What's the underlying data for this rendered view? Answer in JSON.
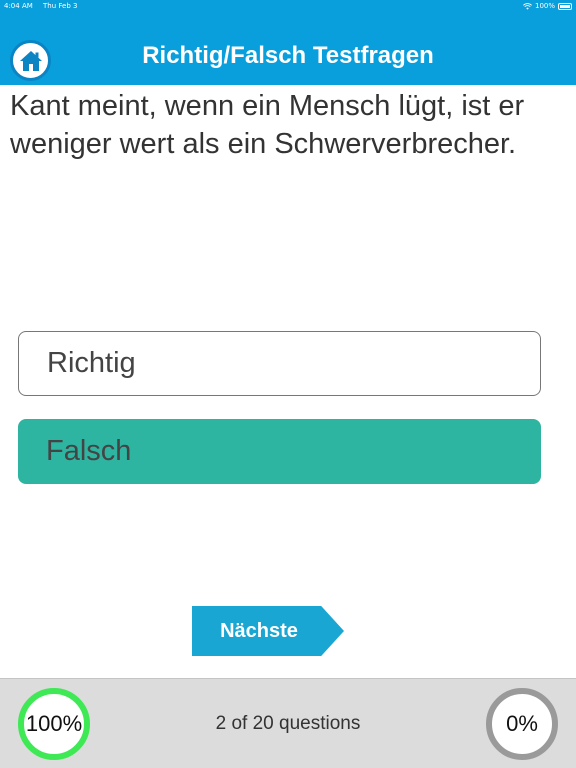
{
  "status_bar": {
    "time": "4:04 AM",
    "date": "Thu Feb 3",
    "battery": "100%",
    "icons": {
      "wifi": "wifi-icon",
      "battery": "battery-icon"
    }
  },
  "nav": {
    "title": "Richtig/Falsch Testfragen",
    "home_icon": "home-icon"
  },
  "question": {
    "text": "Kant meint, wenn ein Mensch lügt, ist er weniger wert als ein Schwerverbrecher."
  },
  "answers": [
    {
      "label": "Richtig",
      "selected": false
    },
    {
      "label": "Falsch",
      "selected": true
    }
  ],
  "next_button": {
    "label": "Nächste"
  },
  "footer": {
    "left_progress": "100%",
    "count_text": "2 of 20 questions",
    "right_progress": "0%"
  },
  "colors": {
    "header": "#089fdc",
    "selected_answer": "#2db5a2",
    "next_button": "#1aa6d3",
    "left_ring": "#3fe855",
    "right_ring": "#9a9a9a",
    "footer": "#dcdcdc"
  }
}
